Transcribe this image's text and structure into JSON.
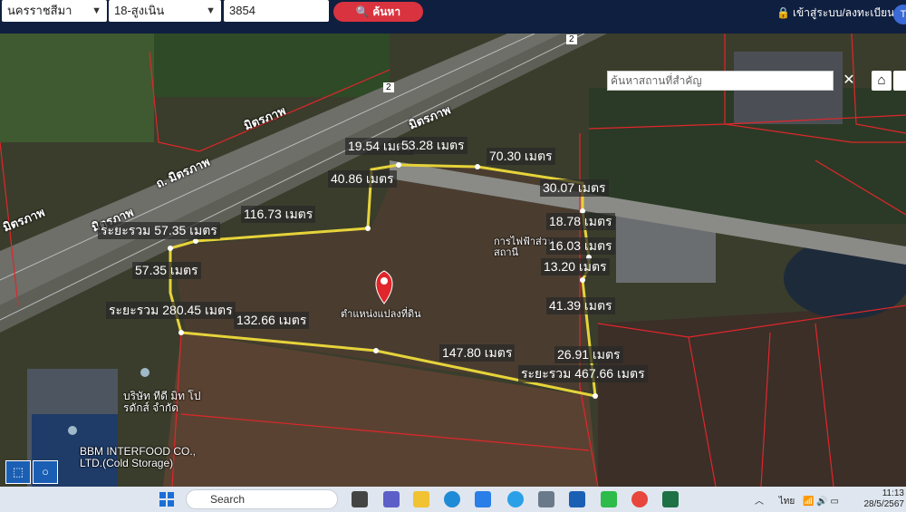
{
  "topbar": {
    "province": "นครราชสีมา",
    "district": "18-สูงเนิน",
    "parcel_number": "3854",
    "search_label": "ค้นหา",
    "login_label": "เข้าสู่ระบบ/ลงทะเบียน",
    "user_initial": "T"
  },
  "map": {
    "place_search_placeholder": "ค้นหาสถานที่สำคัญ",
    "clear_label": "✕",
    "home_icon": "home-icon",
    "pin_label": "ตำแหน่งแปลงที่ดิน",
    "road_labels": [
      "มิตรภาพ",
      "มิตรภาพ",
      "ถ. มิตรภาพ",
      "มิตรภาพ",
      "มิตรภาพ"
    ],
    "route_numbers": [
      "2",
      "2"
    ],
    "poi": {
      "substation": "การไฟฟ้าส่วน สถานี",
      "company": "บริษัท ทีดี มิท โปรดักส์ จำกัด",
      "bbm": "BBM INTERFOOD CO.,\nLTD.(Cold Storage)"
    },
    "measurements": {
      "m1": "19.54 เมตร",
      "m2": "53.28 เมตร",
      "m3": "70.30 เมตร",
      "m4": "40.86 เมตร",
      "m5": "30.07 เมตร",
      "m6": "116.73 เมตร",
      "m7": "ระยะรวม 57.35 เมตร",
      "m8": "18.78 เมตร",
      "m9": "16.03 เมตร",
      "m10": "13.20 เมตร",
      "m11": "57.35 เมตร",
      "m12": "ระยะรวม 280.45 เมตร",
      "m13": "132.66 เมตร",
      "m14": "41.39 เมตร",
      "m15": "147.80 เมตร",
      "m16": "26.91 เมตร",
      "m17": "ระยะรวม 467.66 เมตร"
    },
    "colors": {
      "parcel_line": "#e6d33a",
      "boundary": "#e0262b",
      "pin": "#e0262b",
      "draw_tool": "#1b5fb4"
    }
  },
  "taskbar": {
    "search_placeholder": "Search",
    "tray_lang": "ไทย",
    "time": "11:13",
    "date": "28/5/2567"
  }
}
